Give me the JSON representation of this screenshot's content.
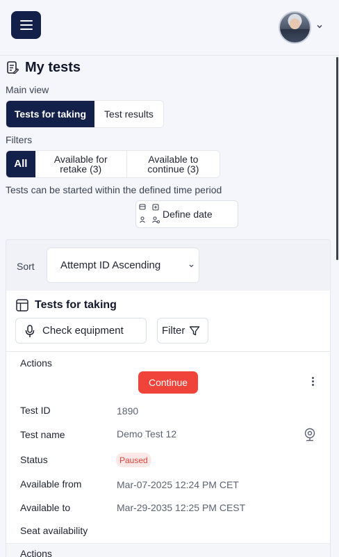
{
  "header": {
    "menu_icon": "hamburger-icon",
    "avatar": "user-avatar",
    "avatar_menu_icon": "chevron-down-icon"
  },
  "page": {
    "title": "My tests",
    "title_icon": "clipboard-edit-icon"
  },
  "main_view": {
    "label": "Main view",
    "tabs": [
      {
        "label": "Tests for taking",
        "active": true
      },
      {
        "label": "Test results",
        "active": false
      }
    ]
  },
  "filters": {
    "label": "Filters",
    "options": [
      {
        "label": "All",
        "active": true
      },
      {
        "label": "Available for retake (3)",
        "active": false
      },
      {
        "label": "Available to continue (3)",
        "active": false
      }
    ],
    "hint": "Tests can be started within the defined time period",
    "define_date_label": "Define date",
    "define_date_icon": "calendar-users-icon"
  },
  "sort": {
    "label": "Sort",
    "selected": "Attempt ID Ascending"
  },
  "tests_section": {
    "title": "Tests for taking",
    "title_icon": "table-icon",
    "check_equipment_label": "Check equipment",
    "check_equipment_icon": "microphone-icon",
    "filter_label": "Filter",
    "filter_icon": "funnel-icon"
  },
  "test_card": {
    "actions_label": "Actions",
    "continue_label": "Continue",
    "more_icon": "kebab-icon",
    "fields": {
      "test_id_label": "Test ID",
      "test_id_value": "1890",
      "test_name_label": "Test name",
      "test_name_value": "Demo Test 12",
      "test_name_icon": "webcam-icon",
      "status_label": "Status",
      "status_value": "Paused",
      "available_from_label": "Available from",
      "available_from_value": "Mar-07-2025 12:24 PM CET",
      "available_to_label": "Available to",
      "available_to_value": "Mar-29-2035 12:25 PM CEST",
      "seat_label": "Seat availability"
    }
  },
  "next_card": {
    "actions_label": "Actions"
  },
  "colors": {
    "primary": "#12204a",
    "danger": "#f0443a",
    "paused_bg": "#fde8e8",
    "paused_text": "#e0433a"
  }
}
